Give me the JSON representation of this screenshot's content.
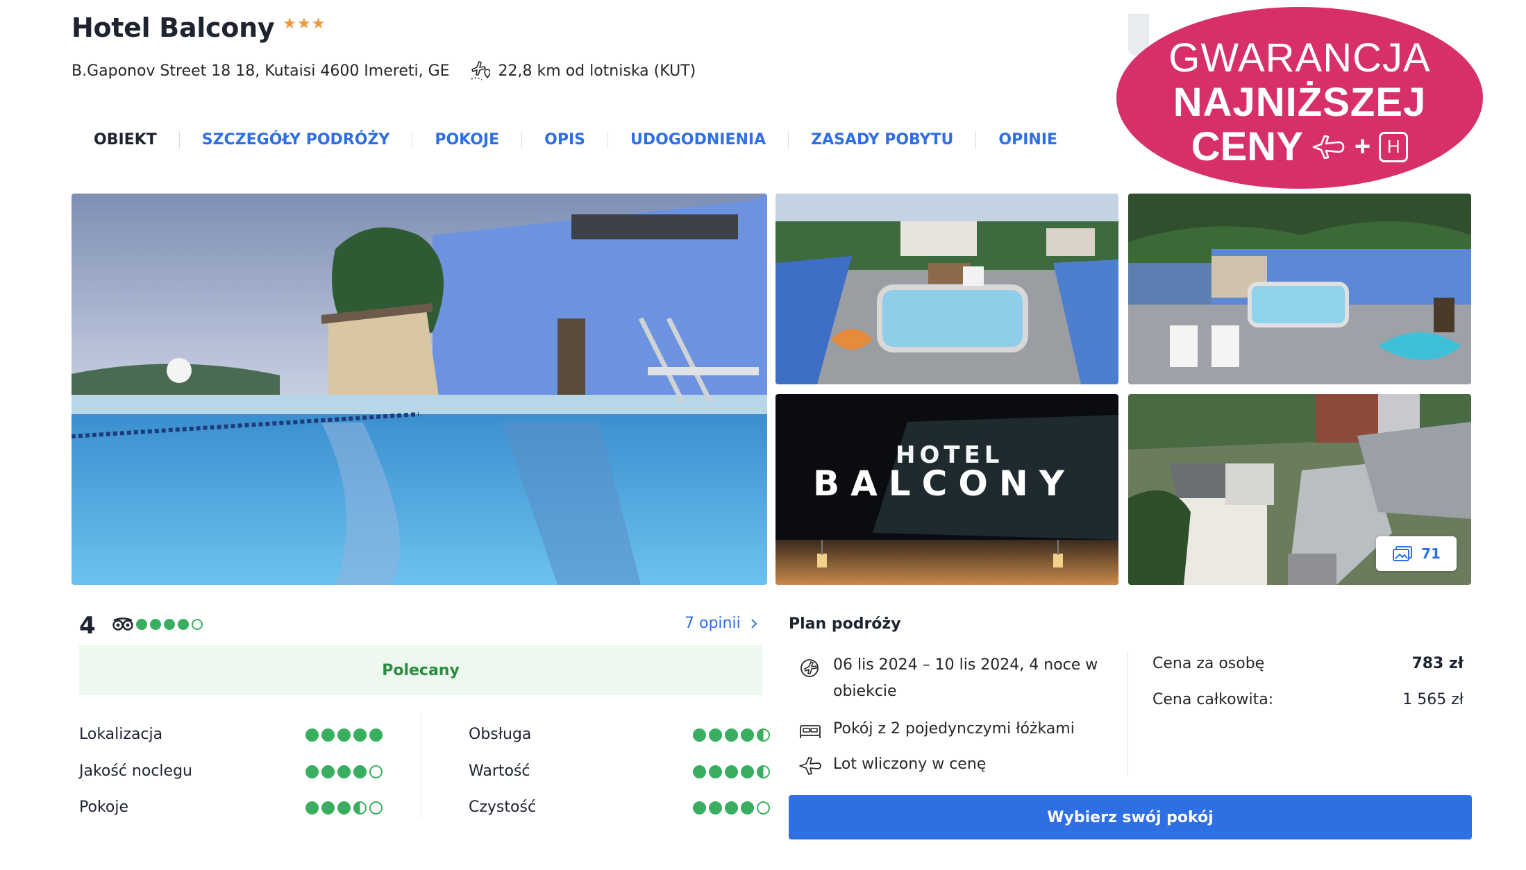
{
  "hotel": {
    "name": "Hotel Balcony",
    "stars": "★★★",
    "address": "B.Gaponov Street 18 18, Kutaisi 4600 Imereti, GE",
    "airport_distance": "22,8 km od lotniska (KUT)"
  },
  "nav": {
    "items": [
      {
        "label": "OBIEKT"
      },
      {
        "label": "SZCZEGÓŁY PODRÓŻY"
      },
      {
        "label": "POKOJE"
      },
      {
        "label": "OPIS"
      },
      {
        "label": "UDOGODNIENIA"
      },
      {
        "label": "ZASADY POBYTU"
      },
      {
        "label": "OPINIE"
      }
    ]
  },
  "badge": {
    "line1": "GWARANCJA",
    "line2": "NAJNIŻSZEJ",
    "line3": "CENY",
    "icon_text": "+",
    "h_letter": "H",
    "color": "#d72f6a"
  },
  "gallery": {
    "sign_top": "HOTEL",
    "sign_bottom": "BALCONY",
    "photo_count": "71"
  },
  "rating": {
    "score": "4",
    "ta_dots": 4,
    "opinions_link": "7 opinii",
    "recommended_label": "Polecany",
    "categories": [
      {
        "label": "Lokalizacja",
        "value": 5
      },
      {
        "label": "Jakość noclegu",
        "value": 4
      },
      {
        "label": "Pokoje",
        "value": 3.5
      },
      {
        "label": "Obsługa",
        "value": 4.5
      },
      {
        "label": "Wartość",
        "value": 4.5
      },
      {
        "label": "Czystość",
        "value": 4
      }
    ]
  },
  "plan": {
    "title": "Plan podróży",
    "dates_line1": "06 lis 2024 – 10 lis 2024, 4 noce w",
    "dates_line2": "obiekcie",
    "room": "Pokój z 2 pojedynczymi łóżkami",
    "flight": "Lot wliczony w cenę",
    "price_per_person_label": "Cena za osobę",
    "price_per_person": "783 zł",
    "total_label": "Cena całkowita:",
    "total": "1 565 zł",
    "cta_label": "Wybierz swój pokój"
  },
  "colors": {
    "accent": "#2f6fe4",
    "rating_green": "#3aae60",
    "star_orange": "#f0963c"
  }
}
